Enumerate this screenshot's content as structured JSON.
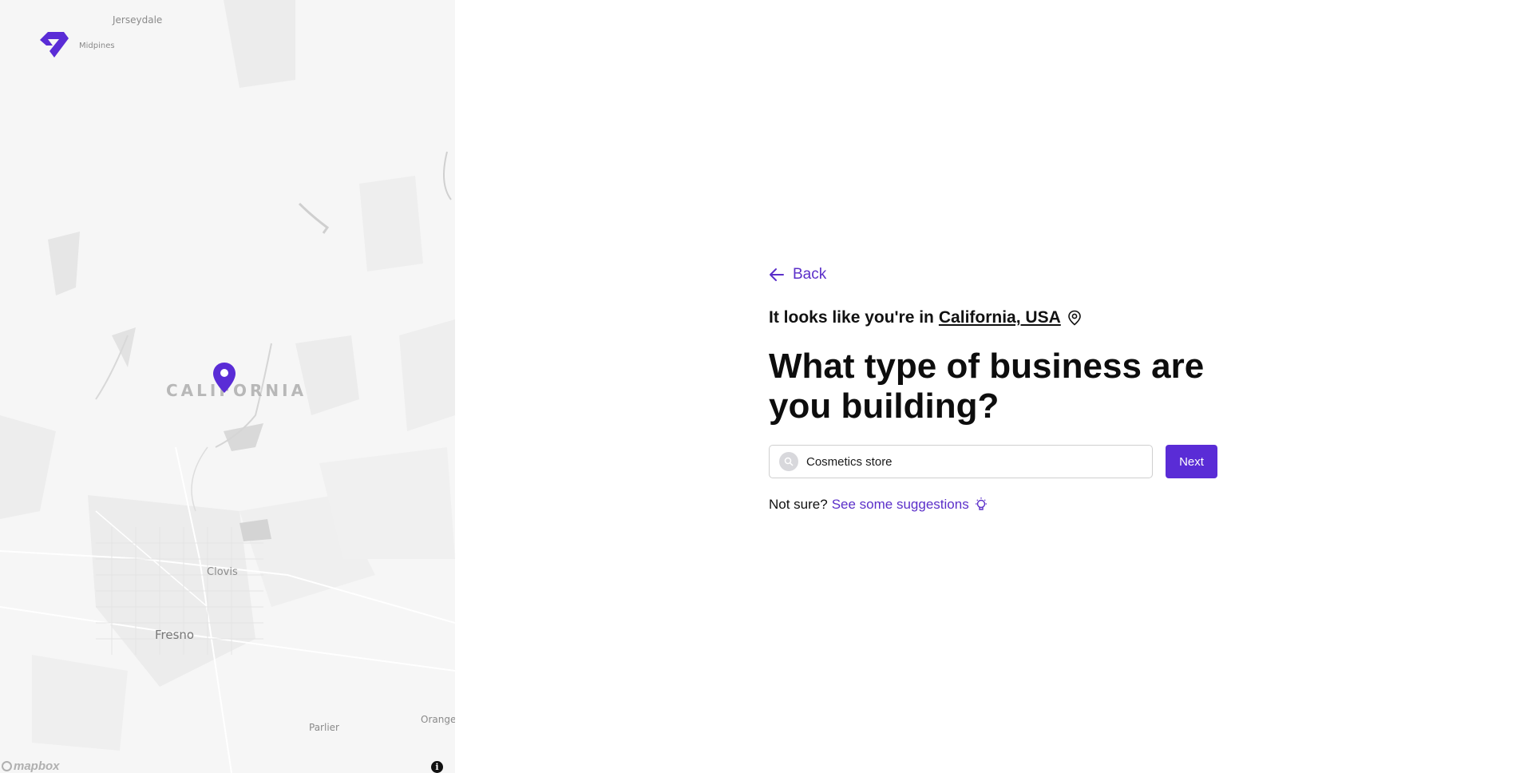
{
  "map": {
    "labels": {
      "jerseydale": "Jerseydale",
      "midpines": "Midpines",
      "california": "CALIFORNIA",
      "clovis": "Clovis",
      "fresno": "Fresno",
      "parlier": "Parlier",
      "orange": "Orange"
    },
    "attribution": "mapbox",
    "info_icon": "i",
    "pin_color": "#5a2cd6"
  },
  "brand": {
    "logo_icon": "diamond-logo",
    "color": "#5a2cd6"
  },
  "form": {
    "back_label": "Back",
    "location_prefix": "It looks like you're in",
    "location_value": "California, USA",
    "headline": "What type of business are you building?",
    "search": {
      "value": "Cosmetics store",
      "placeholder": ""
    },
    "next_label": "Next",
    "suggest_prefix": "Not sure?",
    "suggest_link": "See some suggestions"
  }
}
